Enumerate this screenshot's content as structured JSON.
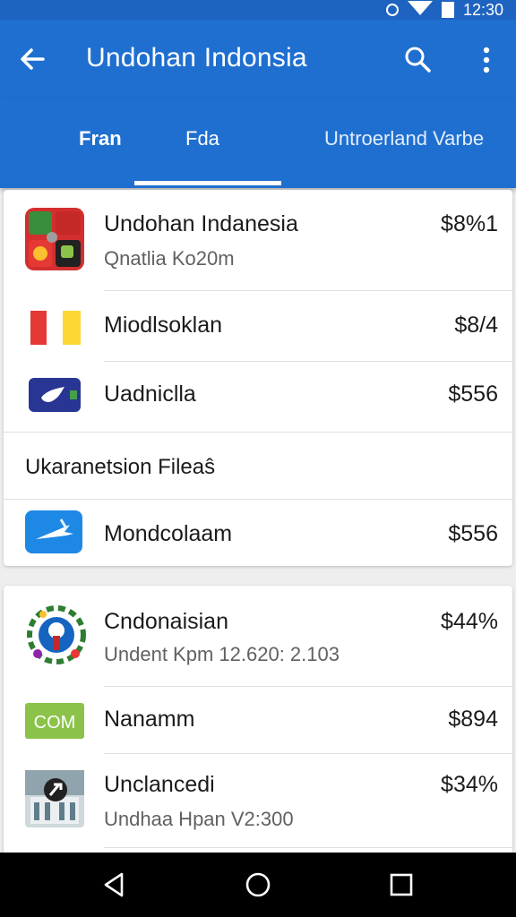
{
  "status_bar": {
    "time": "12:30",
    "icons": [
      "circle-icon",
      "wifi-icon",
      "battery-icon"
    ]
  },
  "app_bar": {
    "title": "Undohan Indonsia",
    "icons": [
      "back-arrow-icon",
      "search-icon",
      "more-vert-icon"
    ]
  },
  "tabs": [
    {
      "label": "Fran",
      "selected": false
    },
    {
      "label": "Fda",
      "selected": true
    },
    {
      "label": "Untroerland Varbe",
      "selected": false
    }
  ],
  "card_1": {
    "items": [
      {
        "name": "Undohan Indanesia",
        "subtitle": "Qnatlia Ko20m",
        "price": "$8%1",
        "icon": "colorful-grid-app-icon"
      },
      {
        "name": "Miodlsoklan",
        "price": "$8/4",
        "icon": "red-yellow-flag-icon"
      },
      {
        "name": "Uadniclla",
        "price": "$556",
        "icon": "blue-bird-app-icon"
      }
    ],
    "section_header": "Ukaranetsion Fileaŝ",
    "section_items": [
      {
        "name": "Mondcolaam",
        "price": "$556",
        "icon": "airplane-app-icon"
      }
    ]
  },
  "card_2": {
    "items": [
      {
        "name": "Cndonaisian",
        "subtitle": "Undent Kpm 12.620: 2.103",
        "price": "$44%",
        "icon": "emblem-icon"
      },
      {
        "name": "Nanamm",
        "price": "$894",
        "icon": "com-logo-icon",
        "icon_text": "COM"
      },
      {
        "name": "Unclancedi",
        "subtitle": "Undhaa Hpan V2:300",
        "price": "$34%",
        "icon": "building-photo-icon"
      }
    ]
  },
  "nav_bar": {
    "icons": [
      "back-triangle-icon",
      "home-circle-icon",
      "recents-square-icon"
    ]
  },
  "colors": {
    "app_bar": "#1f6fd0",
    "status_bar": "#1e63c0",
    "background": "#eeeeee",
    "nav_bar": "#000000"
  }
}
